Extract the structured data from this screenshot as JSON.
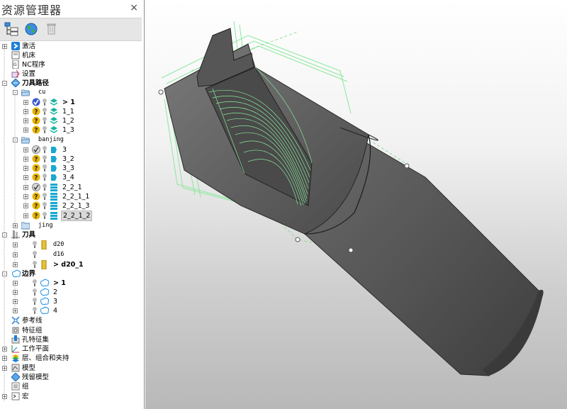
{
  "explorer": {
    "title": "资源管理器",
    "close": "×",
    "toolbar": [
      {
        "name": "tree-view-icon"
      },
      {
        "name": "globe-icon"
      },
      {
        "name": "trash-icon"
      }
    ],
    "tree": {
      "jihuo": "激活",
      "jichuang": "机床",
      "nc": "NC程序",
      "shezhi": "设置",
      "daojulujing": "刀具路径",
      "cu": "cu",
      "cu_items": [
        "> 1",
        "1_1",
        "1_2",
        "1_3"
      ],
      "banjing": "banjing",
      "banjing_items": [
        "3",
        "3_2",
        "3_3",
        "3_4",
        "2_2_1",
        "2_2_1_1",
        "2_2_1_3",
        "2_2_1_2"
      ],
      "jing": "jing",
      "daoju": "刀具",
      "tools": [
        "d20",
        "d16",
        "> d20_1"
      ],
      "bianjie": "边界",
      "boundaries": [
        "> 1",
        "2",
        "3",
        "4"
      ],
      "cankaoxian": "参考线",
      "tezhengzu": "特征组",
      "kongtezhengji": "孔特征集",
      "gongzuopingmian": "工作平面",
      "ceng": "层、组合和夹持",
      "moxing": "模型",
      "canliu": "残留模型",
      "zu": "组",
      "hong": "宏"
    }
  },
  "colors": {
    "toolpath": "#8ae89a",
    "stock": "#5a5a5a",
    "cylinder_dark": "#4a4a4a",
    "accent_blue": "#1e7fd8"
  }
}
